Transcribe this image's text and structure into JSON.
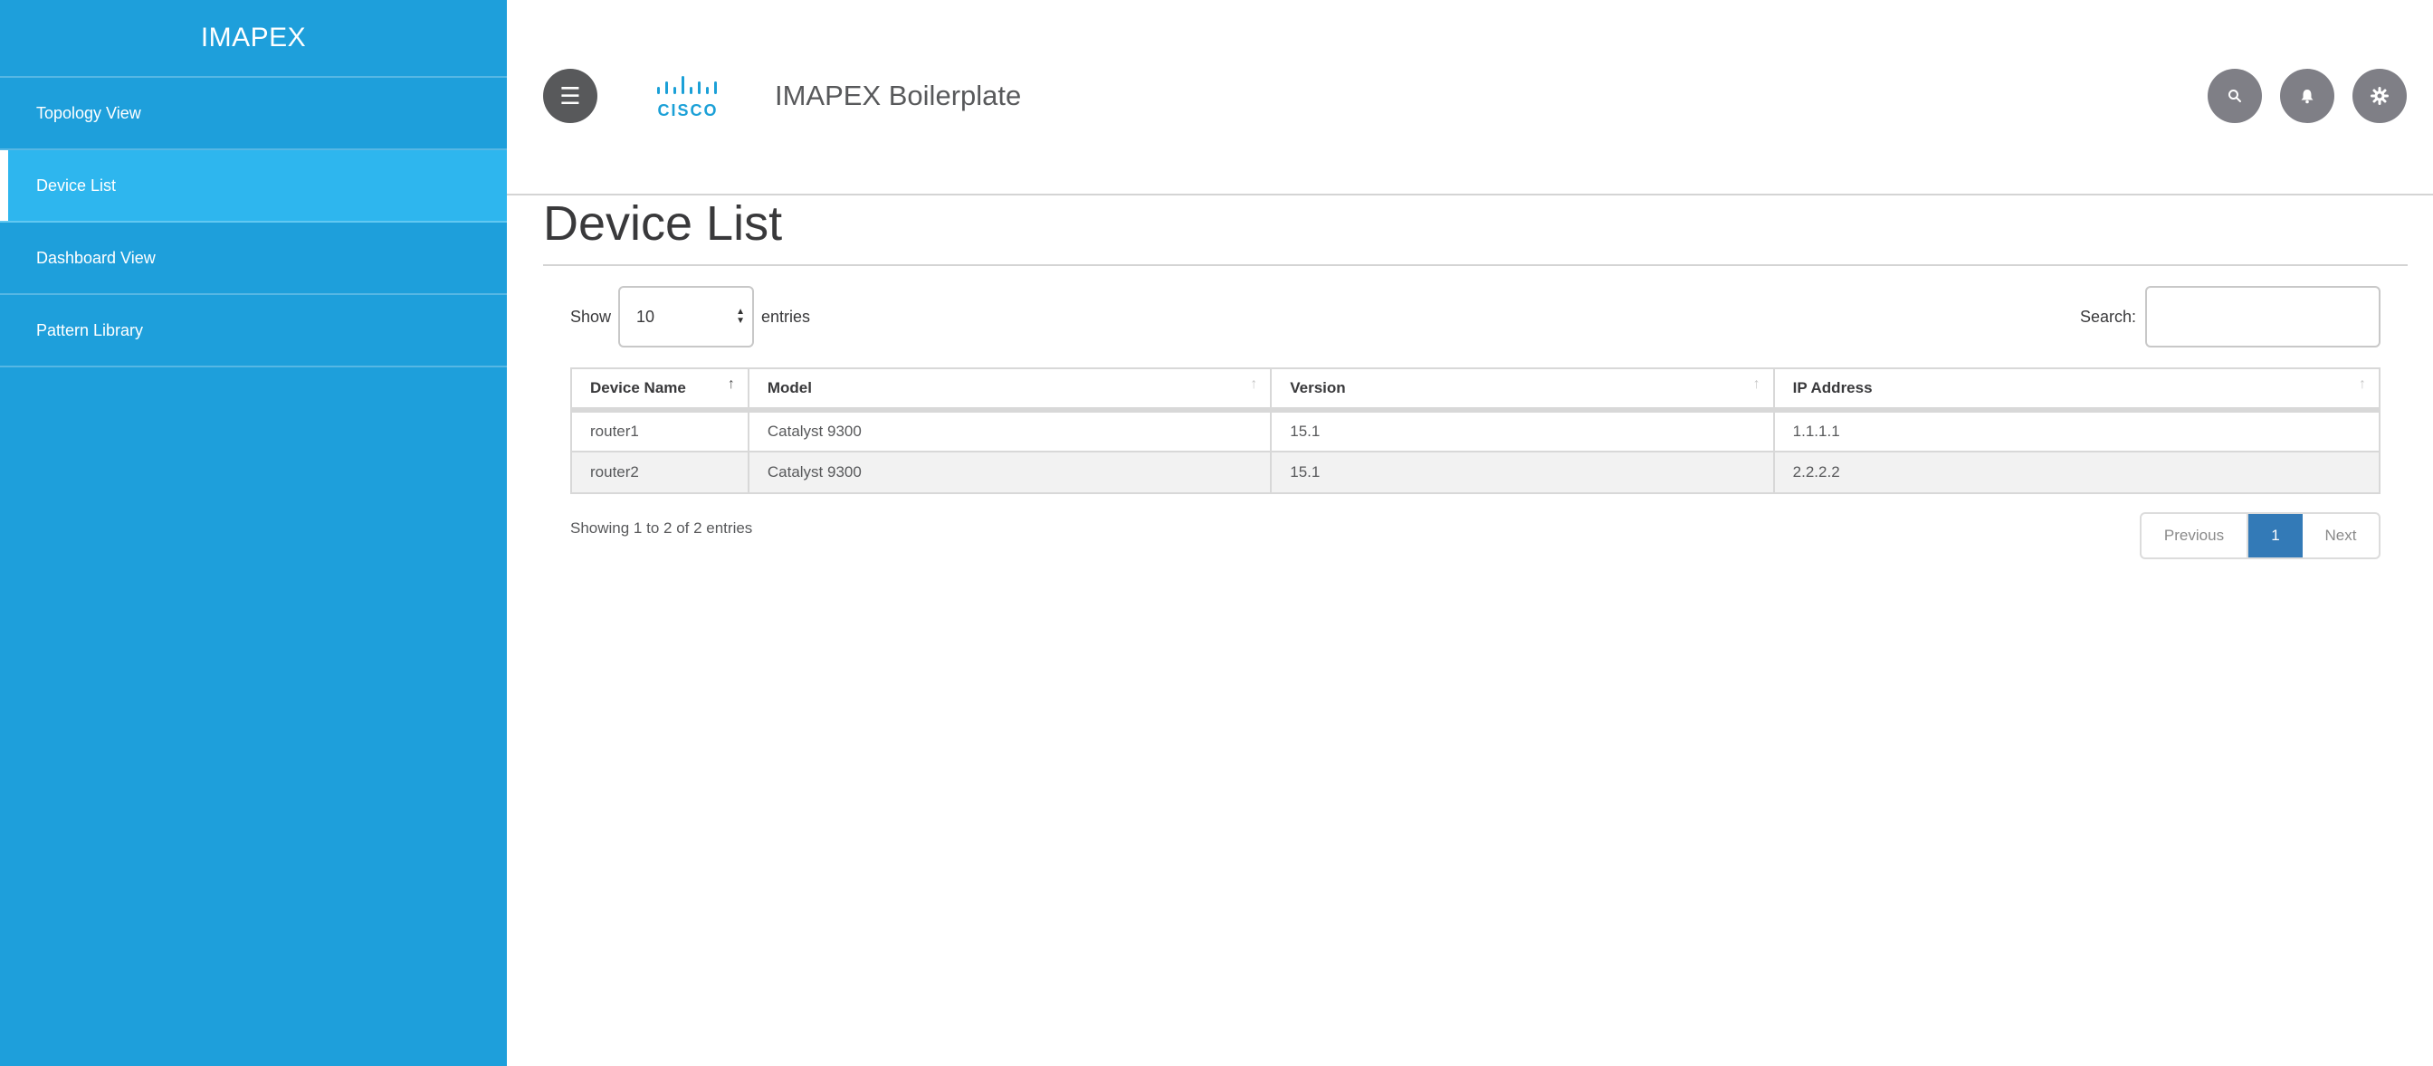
{
  "sidebar": {
    "brand": "IMAPEX",
    "items": [
      {
        "label": "Topology View"
      },
      {
        "label": "Device List"
      },
      {
        "label": "Dashboard View"
      },
      {
        "label": "Pattern Library"
      }
    ]
  },
  "header": {
    "logo_text": "CISCO",
    "title": "IMAPEX Boilerplate",
    "buttons": [
      "search-icon",
      "bell-icon",
      "gear-icon"
    ]
  },
  "page": {
    "title": "Device List",
    "length": {
      "prefix": "Show",
      "value": "10",
      "suffix": "entries"
    },
    "search": {
      "label": "Search:",
      "value": ""
    },
    "table": {
      "columns": [
        "Device Name",
        "Model",
        "Version",
        "IP Address"
      ],
      "rows": [
        [
          "router1",
          "Catalyst 9300",
          "15.1",
          "1.1.1.1"
        ],
        [
          "router2",
          "Catalyst 9300",
          "15.1",
          "2.2.2.2"
        ]
      ]
    },
    "info": "Showing 1 to 2 of 2 entries",
    "pagination": {
      "previous": "Previous",
      "current": "1",
      "next": "Next"
    }
  },
  "colors": {
    "sidebar": "#1e9fdb",
    "sidebar_active": "#2eb6ee",
    "page_active": "#337ab7"
  }
}
